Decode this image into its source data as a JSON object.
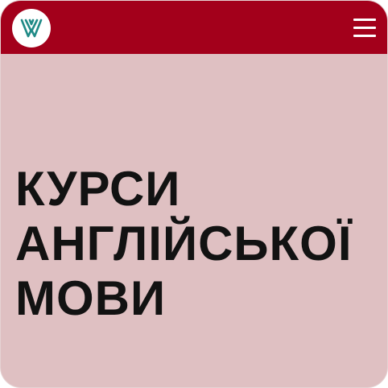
{
  "header": {
    "logo_icon": "leaf-v-logo-icon",
    "menu_icon": "hamburger-menu-icon",
    "background_color": "#a3001b"
  },
  "hero": {
    "title_lines": [
      "КУРСИ",
      "АНГЛІЙСЬКОЇ",
      "МОВИ"
    ],
    "background_color": "#dfc0c2"
  }
}
